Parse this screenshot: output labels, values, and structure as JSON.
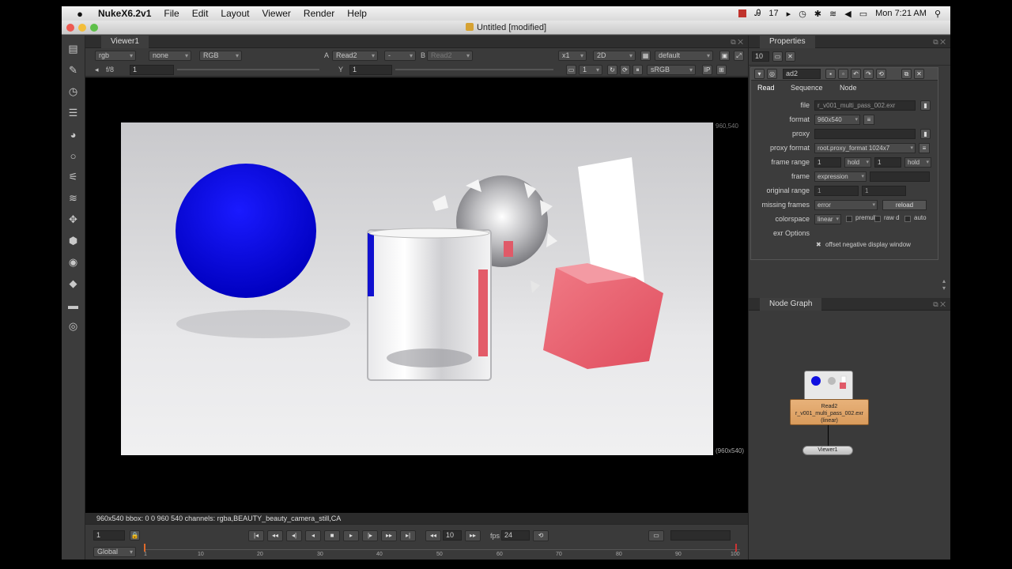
{
  "menubar": {
    "app_name": "NukeX6.2v1",
    "menus": [
      "File",
      "Edit",
      "Layout",
      "Viewer",
      "Render",
      "Help"
    ],
    "status_items": [
      "17"
    ],
    "clock": "Mon 7:21 AM"
  },
  "window": {
    "title": "Untitled [modified]"
  },
  "viewer": {
    "tab_label": "Viewer1",
    "channels": "rgb",
    "alpha_channel": "none",
    "display": "RGB",
    "input_a_label": "A",
    "input_a": "Read2",
    "input_b_separator": "-",
    "input_b_label": "B",
    "input_b": "Read2",
    "zoom": "x1",
    "view_mode": "2D",
    "lut_default": "default",
    "fstop_label": "f/8",
    "gain_value": "1",
    "gamma_label": "Y",
    "gamma_value": "1",
    "proxy_value": "1",
    "colorspace": "sRGB",
    "format_top_right": "960,540",
    "format_bottom_right": "(960x540)",
    "status_text": "960x540 bbox: 0 0 960 540 channels: rgba,BEAUTY_beauty_camera_still,CA"
  },
  "timeline": {
    "frame": "1",
    "increment": "10",
    "fps_label": "fps",
    "fps": "24",
    "scope": "Global",
    "ticks": [
      "1",
      "10",
      "20",
      "30",
      "40",
      "50",
      "60",
      "70",
      "80",
      "90",
      "100"
    ]
  },
  "properties": {
    "tab_label": "Properties",
    "max_panels": "10",
    "node_name": "ad2",
    "subtabs": [
      "Read",
      "Sequence",
      "Node"
    ],
    "rows": {
      "file_label": "file",
      "file_value": "r_v001_multi_pass_002.exr",
      "format_label": "format",
      "format_value": "960x540",
      "proxy_label": "proxy",
      "proxy_format_label": "proxy format",
      "proxy_format_value": "root.proxy_format 1024x7",
      "frame_range_label": "frame range",
      "frame_range_start": "1",
      "frame_range_hold1": "hold",
      "frame_range_end": "1",
      "frame_range_hold2": "hold",
      "frame_label": "frame",
      "frame_mode": "expression",
      "original_range_label": "original range",
      "original_range_start": "1",
      "original_range_end": "1",
      "missing_frames_label": "missing frames",
      "missing_frames_value": "error",
      "reload_label": "reload",
      "colorspace_label": "colorspace",
      "colorspace_value": "linear",
      "premultiplied_label": "premult",
      "raw_label": "raw d",
      "auto_label": "auto",
      "exr_options_label": "exr Options",
      "offset_label": "offset negative display window"
    }
  },
  "node_graph": {
    "tab_label": "Node Graph",
    "read_node": {
      "name": "Read2",
      "file": "r_v001_multi_pass_002.exr",
      "colorspace": "(linear)"
    },
    "viewer_node": "Viewer1"
  }
}
